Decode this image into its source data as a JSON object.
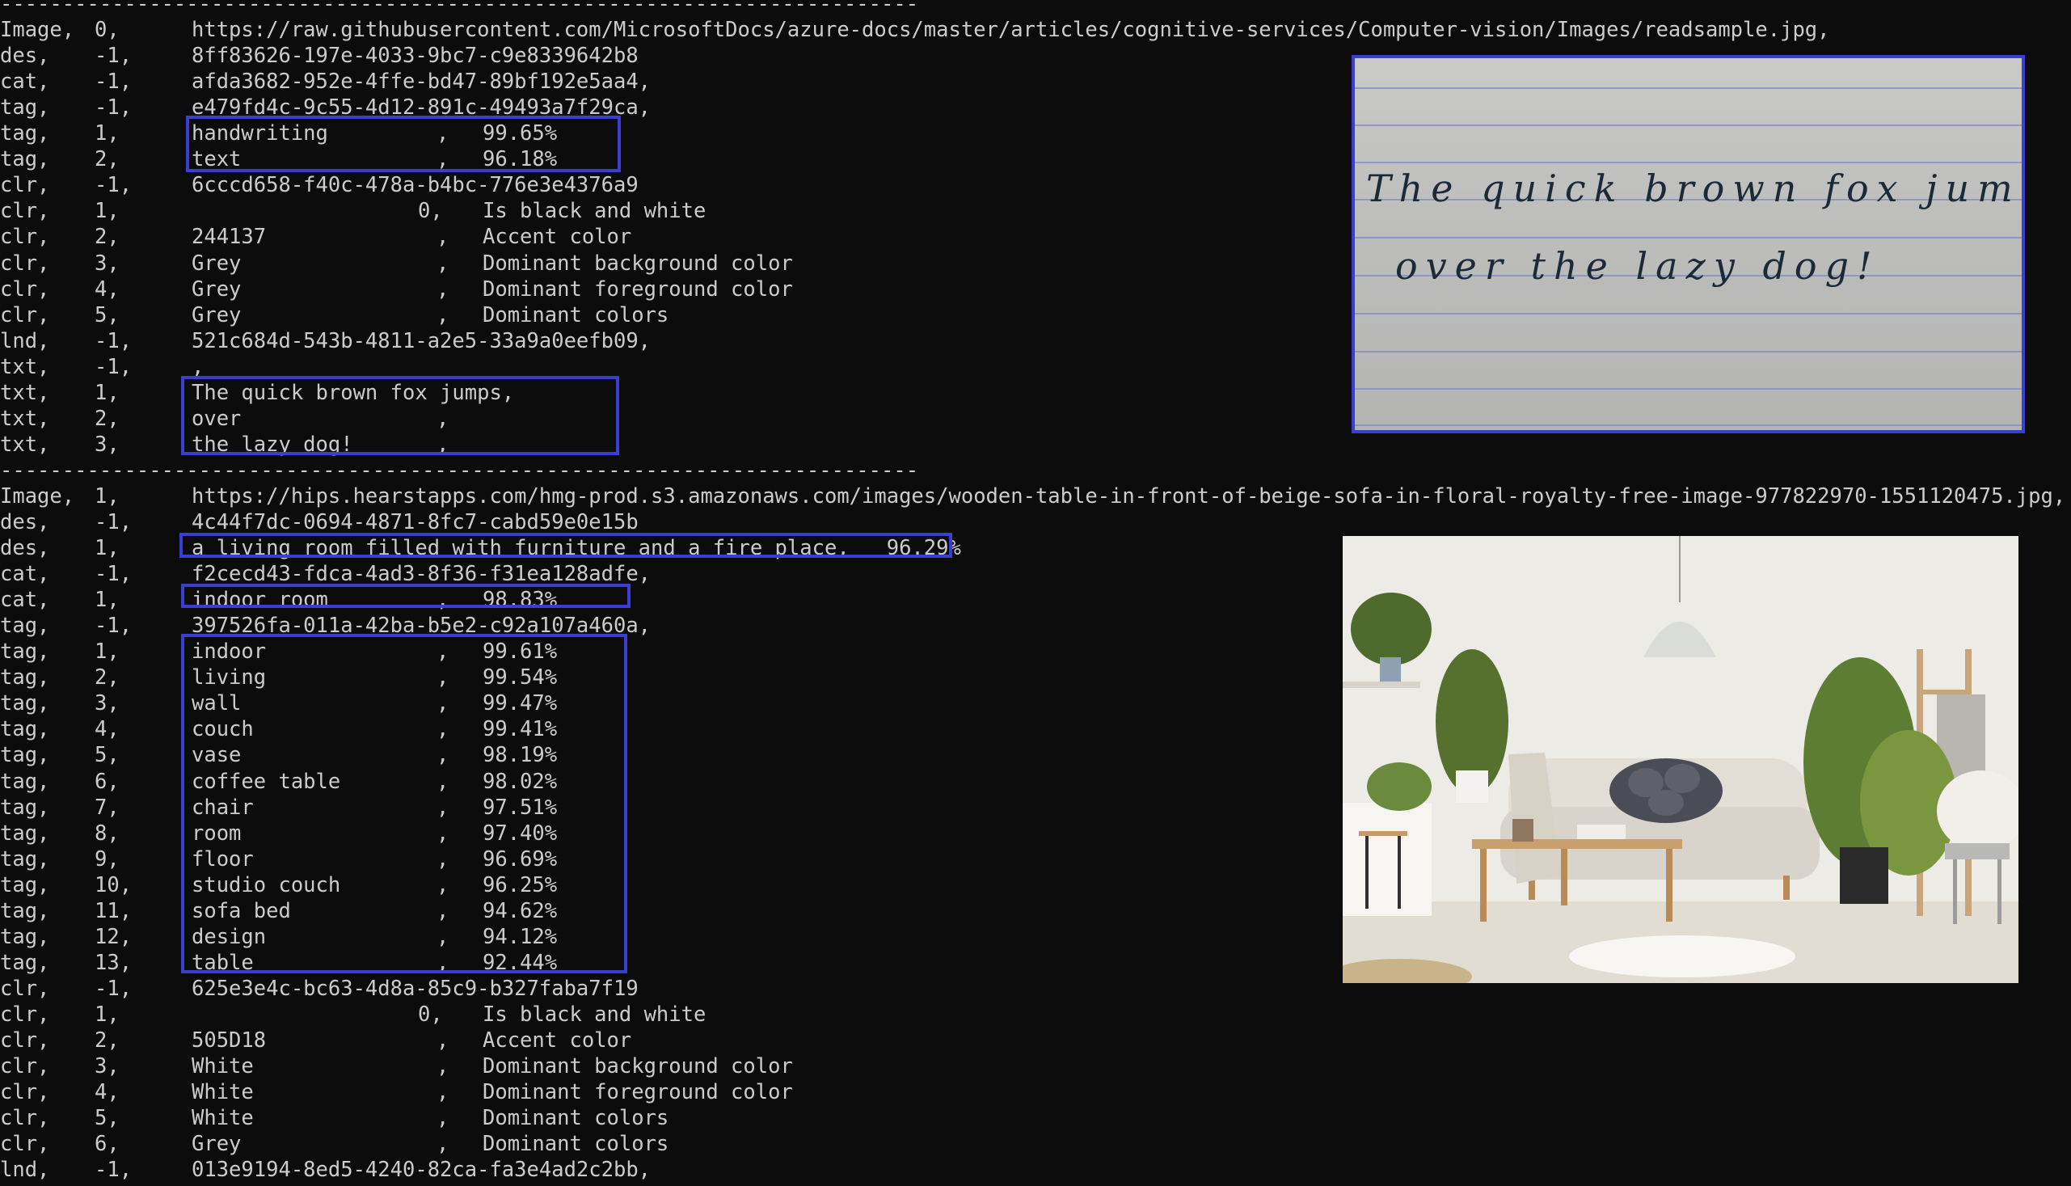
{
  "separators": [
    "--------------------------------------------------------------------------",
    "--------------------------------------------------------------------------"
  ],
  "image0": {
    "lines": [
      [
        "Image,",
        "0,",
        "https://raw.githubusercontent.com/MicrosoftDocs/azure-docs/master/articles/cognitive-services/Computer-vision/Images/readsample.jpg,",
        "",
        ""
      ],
      [
        "des,",
        "-1,",
        "8ff83626-197e-4033-9bc7-c9e8339642b8",
        "",
        ""
      ],
      [
        "cat,",
        "-1,",
        "afda3682-952e-4ffe-bd47-89bf192e5aa4,",
        "",
        ""
      ],
      [
        "tag,",
        "-1,",
        "e479fd4c-9c55-4d12-891c-49493a7f29ca,",
        "",
        ""
      ],
      [
        "tag,",
        "1,",
        "handwriting",
        ",",
        "99.65%"
      ],
      [
        "tag,",
        "2,",
        "text",
        ",",
        "96.18%"
      ],
      [
        "clr,",
        "-1,",
        "6cccd658-f40c-478a-b4bc-776e3e4376a9",
        "",
        ""
      ],
      [
        "clr,",
        "1,",
        "",
        "0,",
        "Is black and white"
      ],
      [
        "clr,",
        "2,",
        "244137",
        ",",
        "Accent color"
      ],
      [
        "clr,",
        "3,",
        "Grey",
        ",",
        "Dominant background color"
      ],
      [
        "clr,",
        "4,",
        "Grey",
        ",",
        "Dominant foreground color"
      ],
      [
        "clr,",
        "5,",
        "Grey",
        ",",
        "Dominant colors"
      ],
      [
        "lnd,",
        "-1,",
        "521c684d-543b-4811-a2e5-33a9a0eefb09,",
        "",
        ""
      ],
      [
        "txt,",
        "-1,",
        ",",
        "",
        ""
      ],
      [
        "txt,",
        "1,",
        "The quick brown fox jumps,",
        "",
        ""
      ],
      [
        "txt,",
        "2,",
        "over",
        ",",
        ""
      ],
      [
        "txt,",
        "3,",
        "the lazy dog!",
        ",",
        ""
      ]
    ],
    "handwriting_lines": [
      "The quick brown fox jumps",
      "over the lazy dog!"
    ]
  },
  "image1": {
    "lines": [
      [
        "Image,",
        "1,",
        "https://hips.hearstapps.com/hmg-prod.s3.amazonaws.com/images/wooden-table-in-front-of-beige-sofa-in-floral-royalty-free-image-977822970-1551120475.jpg,",
        "",
        ""
      ],
      [
        "des,",
        "-1,",
        "4c44f7dc-0694-4871-8fc7-cabd59e0e15b",
        "",
        ""
      ],
      [
        "des,",
        "1,",
        "a living room filled with furniture and a fire place,   96.29%",
        "",
        ""
      ],
      [
        "cat,",
        "-1,",
        "f2cecd43-fdca-4ad3-8f36-f31ea128adfe,",
        "",
        ""
      ],
      [
        "cat,",
        "1,",
        "indoor room",
        ",",
        "98.83%"
      ],
      [
        "tag,",
        "-1,",
        "397526fa-011a-42ba-b5e2-c92a107a460a,",
        "",
        ""
      ],
      [
        "tag,",
        "1,",
        "indoor",
        ",",
        "99.61%"
      ],
      [
        "tag,",
        "2,",
        "living",
        ",",
        "99.54%"
      ],
      [
        "tag,",
        "3,",
        "wall",
        ",",
        "99.47%"
      ],
      [
        "tag,",
        "4,",
        "couch",
        ",",
        "99.41%"
      ],
      [
        "tag,",
        "5,",
        "vase",
        ",",
        "98.19%"
      ],
      [
        "tag,",
        "6,",
        "coffee table",
        ",",
        "98.02%"
      ],
      [
        "tag,",
        "7,",
        "chair",
        ",",
        "97.51%"
      ],
      [
        "tag,",
        "8,",
        "room",
        ",",
        "97.40%"
      ],
      [
        "tag,",
        "9,",
        "floor",
        ",",
        "96.69%"
      ],
      [
        "tag,",
        "10,",
        "studio couch",
        ",",
        "96.25%"
      ],
      [
        "tag,",
        "11,",
        "sofa bed",
        ",",
        "94.62%"
      ],
      [
        "tag,",
        "12,",
        "design",
        ",",
        "94.12%"
      ],
      [
        "tag,",
        "13,",
        "table",
        ",",
        "92.44%"
      ],
      [
        "clr,",
        "-1,",
        "625e3e4c-bc63-4d8a-85c9-b327faba7f19",
        "",
        ""
      ],
      [
        "clr,",
        "1,",
        "",
        "0,",
        "Is black and white"
      ],
      [
        "clr,",
        "2,",
        "505D18",
        ",",
        "Accent color"
      ],
      [
        "clr,",
        "3,",
        "White",
        ",",
        "Dominant background color"
      ],
      [
        "clr,",
        "4,",
        "White",
        ",",
        "Dominant foreground color"
      ],
      [
        "clr,",
        "5,",
        "White",
        ",",
        "Dominant colors"
      ],
      [
        "clr,",
        "6,",
        "Grey",
        ",",
        "Dominant colors"
      ],
      [
        "lnd,",
        "-1,",
        "013e9194-8ed5-4240-82ca-fa3e4ad2c2bb,",
        "",
        ""
      ]
    ]
  },
  "colors": {
    "background": "#0c0c0c",
    "text": "#cccccc",
    "highlight_box": "#3b3fd1"
  }
}
